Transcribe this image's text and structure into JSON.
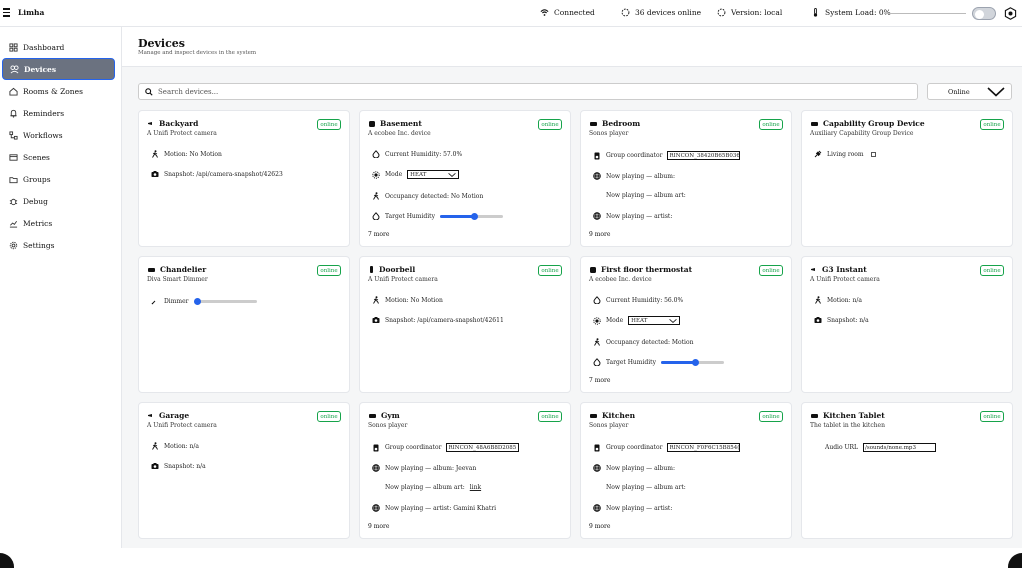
{
  "app": {
    "title": "Limha"
  },
  "status": {
    "connected": "Connected",
    "devices_online": "36 devices online",
    "version": "Version: local",
    "system_load": "System Load: 0%",
    "load_fraction": 0
  },
  "sidebar": {
    "items": [
      {
        "label": "Dashboard",
        "icon": "grid-icon"
      },
      {
        "label": "Devices",
        "icon": "devices-icon",
        "active": true
      },
      {
        "label": "Rooms & Zones",
        "icon": "home-icon"
      },
      {
        "label": "Reminders",
        "icon": "bell-icon"
      },
      {
        "label": "Workflows",
        "icon": "workflow-icon"
      },
      {
        "label": "Scenes",
        "icon": "scenes-icon"
      },
      {
        "label": "Groups",
        "icon": "groups-icon"
      },
      {
        "label": "Debug",
        "icon": "bug-icon"
      },
      {
        "label": "Metrics",
        "icon": "chart-icon"
      },
      {
        "label": "Settings",
        "icon": "gear-icon"
      }
    ]
  },
  "page": {
    "title": "Devices",
    "subtitle": "Manage and inspect devices in the system",
    "search_placeholder": "Search devices...",
    "filter_value": "Online"
  },
  "cards": [
    {
      "name": "Backyard",
      "desc": "A Unifi Protect camera",
      "status": "online",
      "rows": [
        {
          "label": "Motion: No Motion"
        },
        {
          "label": "Snapshot: /api/camera-snapshot/42623"
        }
      ]
    },
    {
      "name": "Basement",
      "desc": "A ecobee Inc. device",
      "status": "online",
      "rows": [
        {
          "label": "Current Humidity: 57.0%"
        },
        {
          "label": "Mode",
          "value": "HEAT"
        },
        {
          "label": "Occupancy detected: No Motion"
        },
        {
          "label": "Target Humidity",
          "level": 0.55
        }
      ],
      "more": "7 more"
    },
    {
      "name": "Bedroom",
      "desc": "Sonos player",
      "status": "online",
      "rows": [
        {
          "label": "Group coordinator",
          "value": "RINCON_38420B65B036"
        },
        {
          "label": "Now playing — album:"
        },
        {
          "label": "Now playing — album art:"
        },
        {
          "label": "Now playing — artist:"
        }
      ],
      "more": "9 more"
    },
    {
      "name": "Capability Group Device",
      "desc": "Auxiliary Capability Group Device",
      "status": "online",
      "rows": [
        {
          "label": "Living room"
        }
      ]
    },
    {
      "name": "Chandelier",
      "desc": "Diva Smart Dimmer",
      "status": "online",
      "rows": [
        {
          "label": "Dimmer",
          "level": 0
        }
      ]
    },
    {
      "name": "Doorbell",
      "desc": "A Unifi Protect camera",
      "status": "online",
      "rows": [
        {
          "label": "Motion: No Motion"
        },
        {
          "label": "Snapshot: /api/camera-snapshot/42611"
        }
      ]
    },
    {
      "name": "First floor thermostat",
      "desc": "A ecobee Inc. device",
      "status": "online",
      "rows": [
        {
          "label": "Current Humidity: 56.0%"
        },
        {
          "label": "Mode",
          "value": "HEAT"
        },
        {
          "label": "Occupancy detected: Motion"
        },
        {
          "label": "Target Humidity",
          "level": 0.55
        }
      ],
      "more": "7 more"
    },
    {
      "name": "G3 Instant",
      "desc": "A Unifi Protect camera",
      "status": "online",
      "rows": [
        {
          "label": "Motion: n/a"
        },
        {
          "label": "Snapshot: n/a"
        }
      ]
    },
    {
      "name": "Garage",
      "desc": "A Unifi Protect camera",
      "status": "online",
      "rows": [
        {
          "label": "Motion: n/a"
        },
        {
          "label": "Snapshot: n/a"
        }
      ]
    },
    {
      "name": "Gym",
      "desc": "Sonos player",
      "status": "online",
      "rows": [
        {
          "label": "Group coordinator",
          "value": "RINCON_48A6B8D2085"
        },
        {
          "label": "Now playing — album: Jeevan"
        },
        {
          "label": "Now playing — album art:",
          "link": "link"
        },
        {
          "label": "Now playing — artist: Gamini Khatri"
        }
      ],
      "more": "9 more"
    },
    {
      "name": "Kitchen",
      "desc": "Sonos player",
      "status": "online",
      "rows": [
        {
          "label": "Group coordinator",
          "value": "RINCON_F0F6C15B854("
        },
        {
          "label": "Now playing — album:"
        },
        {
          "label": "Now playing — album art:"
        },
        {
          "label": "Now playing — artist:"
        }
      ],
      "more": "9 more"
    },
    {
      "name": "Kitchen Tablet",
      "desc": "The tablet in the kitchen",
      "status": "online",
      "rows": [
        {
          "label": "Audio URL",
          "value": "/sounds/none.mp3"
        }
      ]
    }
  ]
}
